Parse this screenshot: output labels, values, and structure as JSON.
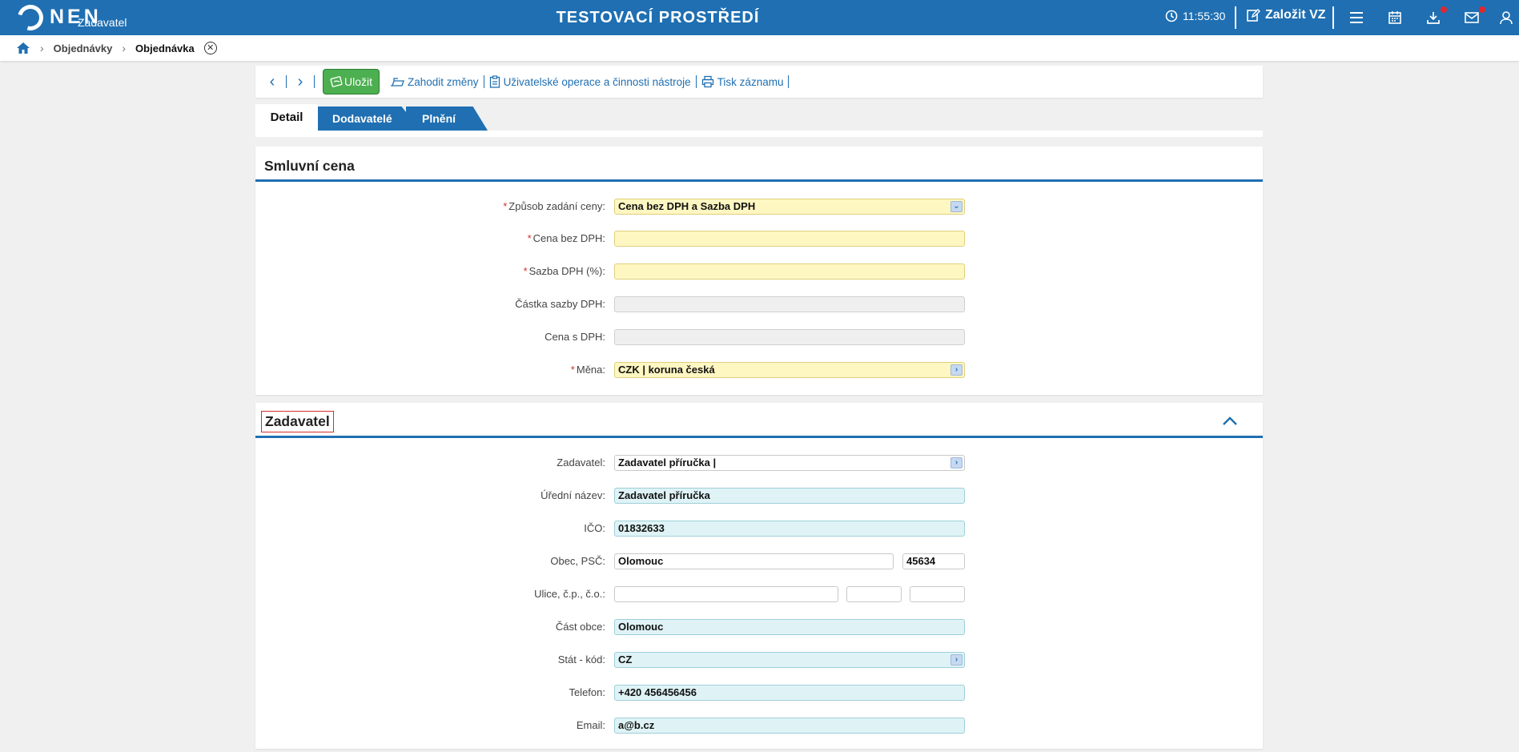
{
  "header": {
    "logo_text": "NEN",
    "logo_sub": "Zadavatel",
    "env_title": "TESTOVACÍ PROSTŘEDÍ",
    "time": "11:55:30",
    "create_label": "Založit VZ",
    "icons": [
      "clock-icon",
      "edit-icon",
      "menu-icon",
      "calendar-icon",
      "download-icon",
      "mail-icon",
      "user-icon"
    ]
  },
  "breadcrumb": {
    "items": [
      "Objednávky",
      "Objednávka"
    ]
  },
  "toolbar": {
    "save_label": "Uložit",
    "discard_label": "Zahodit změny",
    "operations_label": "Uživatelské operace a činnosti nástroje",
    "print_label": "Tisk záznamu"
  },
  "tabs": [
    {
      "label": "Detail",
      "active": true
    },
    {
      "label": "Dodavatelé",
      "active": false
    },
    {
      "label": "Plnění",
      "active": false
    }
  ],
  "smluvni_cena": {
    "title": "Smluvní cena",
    "fields": {
      "zpusob": {
        "label": "Způsob zadání ceny:",
        "value": "Cena bez DPH a Sazba DPH",
        "required": true
      },
      "cena_bez": {
        "label": "Cena bez DPH:",
        "value": "",
        "required": true
      },
      "sazba": {
        "label": "Sazba DPH (%):",
        "value": "",
        "required": true
      },
      "castka": {
        "label": "Částka sazby DPH:",
        "value": ""
      },
      "cena_s": {
        "label": "Cena s DPH:",
        "value": ""
      },
      "mena": {
        "label": "Měna:",
        "value": "CZK | koruna česká",
        "required": true
      }
    }
  },
  "zadavatel": {
    "title": "Zadavatel",
    "fields": {
      "zadavatel": {
        "label": "Zadavatel:",
        "value": "Zadavatel příručka |"
      },
      "uredni": {
        "label": "Úřední název:",
        "value": "Zadavatel příručka"
      },
      "ico": {
        "label": "IČO:",
        "value": "01832633"
      },
      "obec": {
        "label": "Obec, PSČ:",
        "value": "Olomouc",
        "psc": "45634"
      },
      "ulice": {
        "label": "Ulice, č.p., č.o.:",
        "value": "",
        "cp": "",
        "co": ""
      },
      "cast": {
        "label": "Část obce:",
        "value": "Olomouc"
      },
      "stat": {
        "label": "Stát - kód:",
        "value": "CZ"
      },
      "telefon": {
        "label": "Telefon:",
        "value": "+420 456456456"
      },
      "email": {
        "label": "Email:",
        "value": "a@b.cz"
      }
    }
  },
  "colors": {
    "brand_blue": "#1f6fb2",
    "save_green": "#4caf50",
    "required_bg": "#fff7c2",
    "readonly_bg": "#efefef",
    "filled_bg": "#dff3f6",
    "required_star": "#d32f2f"
  }
}
